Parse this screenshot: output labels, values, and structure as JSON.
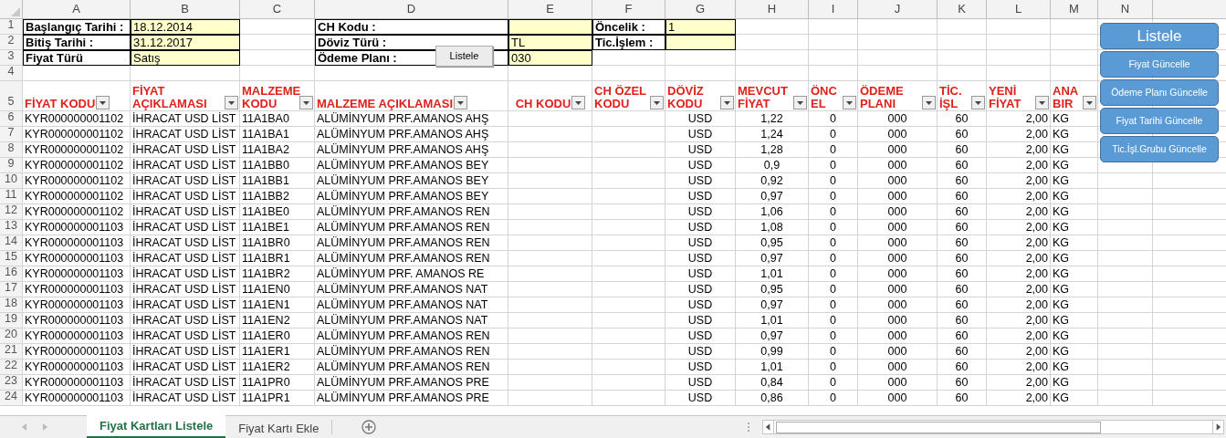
{
  "column_letters": [
    "A",
    "B",
    "C",
    "D",
    "E",
    "F",
    "G",
    "H",
    "I",
    "J",
    "K",
    "L",
    "M",
    "N"
  ],
  "form": {
    "rows": [
      {
        "number": "1",
        "groups": [
          {
            "label": "Başlangıç Tarihi :",
            "value": "18.12.2014"
          },
          {
            "label": "CH Kodu :"
          },
          {
            "label": "Öncelik :",
            "value": "1"
          }
        ]
      },
      {
        "number": "2",
        "groups": [
          {
            "label": "Bitiş Tarihi :",
            "value": "31.12.2017"
          },
          {
            "label": "Döviz Türü :",
            "value": "TL"
          },
          {
            "label": "Tic.İşlem :"
          }
        ]
      },
      {
        "number": "3",
        "groups": [
          {
            "label": "Fiyat Türü",
            "value": "Satış"
          },
          {
            "label": "Ödeme Planı :",
            "value": "030"
          }
        ]
      }
    ],
    "button": "Listele"
  },
  "empty_row_number": "4",
  "header_row": {
    "number": "5",
    "headers": [
      "FİYAT KODU",
      "FİYAT AÇIKLAMASI",
      "MALZEME KODU",
      "MALZEME AÇIKLAMASI",
      "CH KODU",
      "CH ÖZEL KODU",
      "DÖVİZ KODU",
      "MEVCUT FİYAT",
      "ÖNC EL",
      "ÖDEME PLANI",
      "TİC. İŞL",
      "YENİ FİYAT",
      "ANA BIR"
    ]
  },
  "rows": [
    {
      "number": "6",
      "fiyat_kodu": "KYR000000001102",
      "fiyat_aciklamasi": "İHRACAT USD LİST",
      "malzeme_kodu": "11A1BA0",
      "malzeme_aciklamasi": "ALÜMİNYUM PRF.AMANOS AHŞ",
      "doviz_kodu": "USD",
      "mevcut_fiyat": "1,22",
      "oncelik": "0",
      "odeme_plani": "000",
      "tic_isl": "60",
      "yeni_fiyat": "2,00",
      "ana_birim": "KG"
    },
    {
      "number": "7",
      "fiyat_kodu": "KYR000000001102",
      "fiyat_aciklamasi": "İHRACAT USD LİST",
      "malzeme_kodu": "11A1BA1",
      "malzeme_aciklamasi": "ALÜMİNYUM PRF.AMANOS AHŞ",
      "doviz_kodu": "USD",
      "mevcut_fiyat": "1,24",
      "oncelik": "0",
      "odeme_plani": "000",
      "tic_isl": "60",
      "yeni_fiyat": "2,00",
      "ana_birim": "KG"
    },
    {
      "number": "8",
      "fiyat_kodu": "KYR000000001102",
      "fiyat_aciklamasi": "İHRACAT USD LİST",
      "malzeme_kodu": "11A1BA2",
      "malzeme_aciklamasi": "ALÜMİNYUM PRF.AMANOS AHŞ",
      "doviz_kodu": "USD",
      "mevcut_fiyat": "1,28",
      "oncelik": "0",
      "odeme_plani": "000",
      "tic_isl": "60",
      "yeni_fiyat": "2,00",
      "ana_birim": "KG"
    },
    {
      "number": "9",
      "fiyat_kodu": "KYR000000001102",
      "fiyat_aciklamasi": "İHRACAT USD LİST",
      "malzeme_kodu": "11A1BB0",
      "malzeme_aciklamasi": "ALÜMİNYUM PRF.AMANOS BEY",
      "doviz_kodu": "USD",
      "mevcut_fiyat": "0,9",
      "oncelik": "0",
      "odeme_plani": "000",
      "tic_isl": "60",
      "yeni_fiyat": "2,00",
      "ana_birim": "KG"
    },
    {
      "number": "10",
      "fiyat_kodu": "KYR000000001102",
      "fiyat_aciklamasi": "İHRACAT USD LİST",
      "malzeme_kodu": "11A1BB1",
      "malzeme_aciklamasi": "ALÜMİNYUM PRF.AMANOS BEY",
      "doviz_kodu": "USD",
      "mevcut_fiyat": "0,92",
      "oncelik": "0",
      "odeme_plani": "000",
      "tic_isl": "60",
      "yeni_fiyat": "2,00",
      "ana_birim": "KG"
    },
    {
      "number": "11",
      "fiyat_kodu": "KYR000000001102",
      "fiyat_aciklamasi": "İHRACAT USD LİST",
      "malzeme_kodu": "11A1BB2",
      "malzeme_aciklamasi": "ALÜMİNYUM PRF.AMANOS BEY",
      "doviz_kodu": "USD",
      "mevcut_fiyat": "0,97",
      "oncelik": "0",
      "odeme_plani": "000",
      "tic_isl": "60",
      "yeni_fiyat": "2,00",
      "ana_birim": "KG"
    },
    {
      "number": "12",
      "fiyat_kodu": "KYR000000001102",
      "fiyat_aciklamasi": "İHRACAT USD LİST",
      "malzeme_kodu": "11A1BE0",
      "malzeme_aciklamasi": "ALÜMİNYUM PRF.AMANOS REN",
      "doviz_kodu": "USD",
      "mevcut_fiyat": "1,06",
      "oncelik": "0",
      "odeme_plani": "000",
      "tic_isl": "60",
      "yeni_fiyat": "2,00",
      "ana_birim": "KG"
    },
    {
      "number": "13",
      "fiyat_kodu": "KYR000000001103",
      "fiyat_aciklamasi": "İHRACAT USD LİST",
      "malzeme_kodu": "11A1BE1",
      "malzeme_aciklamasi": "ALÜMİNYUM PRF.AMANOS REN",
      "doviz_kodu": "USD",
      "mevcut_fiyat": "1,08",
      "oncelik": "0",
      "odeme_plani": "000",
      "tic_isl": "60",
      "yeni_fiyat": "2,00",
      "ana_birim": "KG"
    },
    {
      "number": "14",
      "fiyat_kodu": "KYR000000001103",
      "fiyat_aciklamasi": "İHRACAT USD LİST",
      "malzeme_kodu": "11A1BR0",
      "malzeme_aciklamasi": "ALÜMİNYUM PRF.AMANOS REN",
      "doviz_kodu": "USD",
      "mevcut_fiyat": "0,95",
      "oncelik": "0",
      "odeme_plani": "000",
      "tic_isl": "60",
      "yeni_fiyat": "2,00",
      "ana_birim": "KG"
    },
    {
      "number": "15",
      "fiyat_kodu": "KYR000000001103",
      "fiyat_aciklamasi": "İHRACAT USD LİST",
      "malzeme_kodu": "11A1BR1",
      "malzeme_aciklamasi": "ALÜMİNYUM PRF.AMANOS REN",
      "doviz_kodu": "USD",
      "mevcut_fiyat": "0,97",
      "oncelik": "0",
      "odeme_plani": "000",
      "tic_isl": "60",
      "yeni_fiyat": "2,00",
      "ana_birim": "KG"
    },
    {
      "number": "16",
      "fiyat_kodu": "KYR000000001103",
      "fiyat_aciklamasi": "İHRACAT USD LİST",
      "malzeme_kodu": "11A1BR2",
      "malzeme_aciklamasi": "ALÜMİNYUM PRF. AMANOS RE",
      "doviz_kodu": "USD",
      "mevcut_fiyat": "1,01",
      "oncelik": "0",
      "odeme_plani": "000",
      "tic_isl": "60",
      "yeni_fiyat": "2,00",
      "ana_birim": "KG"
    },
    {
      "number": "17",
      "fiyat_kodu": "KYR000000001103",
      "fiyat_aciklamasi": "İHRACAT USD LİST",
      "malzeme_kodu": "11A1EN0",
      "malzeme_aciklamasi": "ALÜMİNYUM PRF.AMANOS NAT",
      "doviz_kodu": "USD",
      "mevcut_fiyat": "0,95",
      "oncelik": "0",
      "odeme_plani": "000",
      "tic_isl": "60",
      "yeni_fiyat": "2,00",
      "ana_birim": "KG"
    },
    {
      "number": "18",
      "fiyat_kodu": "KYR000000001103",
      "fiyat_aciklamasi": "İHRACAT USD LİST",
      "malzeme_kodu": "11A1EN1",
      "malzeme_aciklamasi": "ALÜMİNYUM PRF.AMANOS NAT",
      "doviz_kodu": "USD",
      "mevcut_fiyat": "0,97",
      "oncelik": "0",
      "odeme_plani": "000",
      "tic_isl": "60",
      "yeni_fiyat": "2,00",
      "ana_birim": "KG"
    },
    {
      "number": "19",
      "fiyat_kodu": "KYR000000001103",
      "fiyat_aciklamasi": "İHRACAT USD LİST",
      "malzeme_kodu": "11A1EN2",
      "malzeme_aciklamasi": "ALÜMİNYUM PRF.AMANOS NAT",
      "doviz_kodu": "USD",
      "mevcut_fiyat": "1,01",
      "oncelik": "0",
      "odeme_plani": "000",
      "tic_isl": "60",
      "yeni_fiyat": "2,00",
      "ana_birim": "KG"
    },
    {
      "number": "20",
      "fiyat_kodu": "KYR000000001103",
      "fiyat_aciklamasi": "İHRACAT USD LİST",
      "malzeme_kodu": "11A1ER0",
      "malzeme_aciklamasi": "ALÜMİNYUM PRF.AMANOS REN",
      "doviz_kodu": "USD",
      "mevcut_fiyat": "0,97",
      "oncelik": "0",
      "odeme_plani": "000",
      "tic_isl": "60",
      "yeni_fiyat": "2,00",
      "ana_birim": "KG"
    },
    {
      "number": "21",
      "fiyat_kodu": "KYR000000001103",
      "fiyat_aciklamasi": "İHRACAT USD LİST",
      "malzeme_kodu": "11A1ER1",
      "malzeme_aciklamasi": "ALÜMİNYUM PRF.AMANOS REN",
      "doviz_kodu": "USD",
      "mevcut_fiyat": "0,99",
      "oncelik": "0",
      "odeme_plani": "000",
      "tic_isl": "60",
      "yeni_fiyat": "2,00",
      "ana_birim": "KG"
    },
    {
      "number": "22",
      "fiyat_kodu": "KYR000000001103",
      "fiyat_aciklamasi": "İHRACAT USD LİST",
      "malzeme_kodu": "11A1ER2",
      "malzeme_aciklamasi": "ALÜMİNYUM PRF.AMANOS REN",
      "doviz_kodu": "USD",
      "mevcut_fiyat": "1,01",
      "oncelik": "0",
      "odeme_plani": "000",
      "tic_isl": "60",
      "yeni_fiyat": "2,00",
      "ana_birim": "KG"
    },
    {
      "number": "23",
      "fiyat_kodu": "KYR000000001103",
      "fiyat_aciklamasi": "İHRACAT USD LİST",
      "malzeme_kodu": "11A1PR0",
      "malzeme_aciklamasi": "ALÜMİNYUM PRF.AMANOS PRE",
      "doviz_kodu": "USD",
      "mevcut_fiyat": "0,84",
      "oncelik": "0",
      "odeme_plani": "000",
      "tic_isl": "60",
      "yeni_fiyat": "2,00",
      "ana_birim": "KG"
    },
    {
      "number": "24",
      "fiyat_kodu": "KYR000000001103",
      "fiyat_aciklamasi": "İHRACAT USD LİST",
      "malzeme_kodu": "11A1PR1",
      "malzeme_aciklamasi": "ALÜMİNYUM PRF.AMANOS PRE",
      "doviz_kodu": "USD",
      "mevcut_fiyat": "0,86",
      "oncelik": "0",
      "odeme_plani": "000",
      "tic_isl": "60",
      "yeni_fiyat": "2,00",
      "ana_birim": "KG"
    }
  ],
  "action_buttons": [
    {
      "label": "Listele",
      "kind": "primary"
    },
    {
      "label": "Fiyat Güncelle",
      "kind": "secondary"
    },
    {
      "label": "Ödeme Planı Güncelle",
      "kind": "secondary"
    },
    {
      "label": "Fiyat Tarihi Güncelle",
      "kind": "secondary"
    },
    {
      "label": "Tic.İşl.Grubu Güncelle",
      "kind": "secondary"
    }
  ],
  "sheet_tabs": [
    {
      "label": "Fiyat Kartları Listele",
      "selected": true
    },
    {
      "label": "Fiyat Kartı Ekle",
      "selected": false
    }
  ]
}
